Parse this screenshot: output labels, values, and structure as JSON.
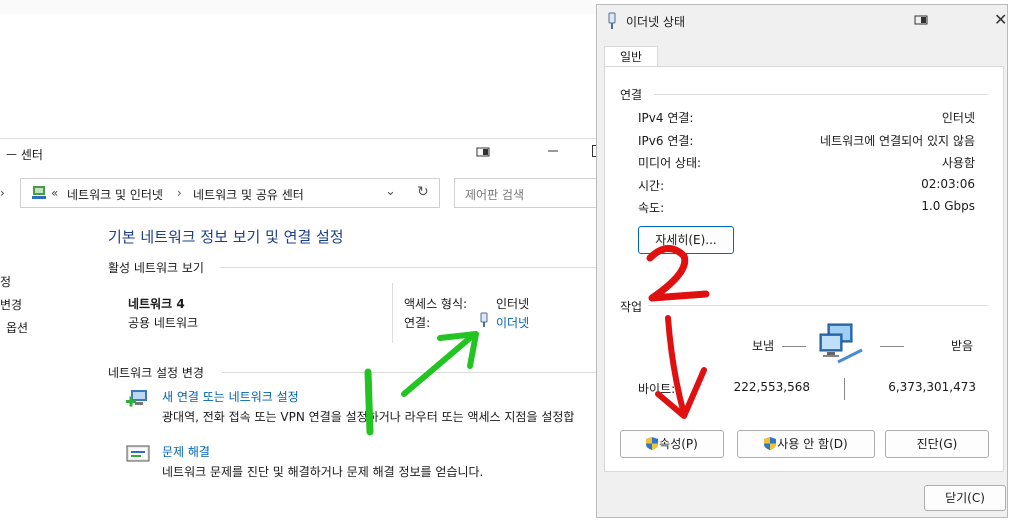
{
  "background_window": {
    "title_fragment": "ㅡ 센터",
    "breadcrumb": {
      "chevrons": "«",
      "items": [
        "네트워크 및 인터넷",
        "네트워크 및 공유 센터"
      ],
      "separator": "›"
    },
    "search_placeholder": "제어판 검색",
    "left_nav": [
      "정",
      "변경",
      "옵션"
    ],
    "heading": "기본 네트워크 정보 보기 및 연결 설정",
    "active_section": "활성 네트워크 보기",
    "network_name": "네트워크 4",
    "network_type": "공용 네트워크",
    "access_type_label": "액세스 형식:",
    "access_type_value": "인터넷",
    "connection_label": "연결:",
    "connection_value": "이더넷",
    "change_section": "네트워크 설정 변경",
    "new_connection_link": "새 연결 또는 네트워크 설정",
    "new_connection_desc": "광대역, 전화 접속 또는 VPN 연결을 설정하거나 라우터 또는 액세스 지점을 설정합",
    "troubleshoot_link": "문제 해결",
    "troubleshoot_desc": "네트워크 문제를 진단 및 해결하거나 문제 해결 정보를 얻습니다."
  },
  "dialog": {
    "title": "이더넷 상태",
    "tab": "일반",
    "connection_section": "연결",
    "rows": [
      {
        "label": "IPv4 연결:",
        "value": "인터넷"
      },
      {
        "label": "IPv6 연결:",
        "value": "네트워크에 연결되어 있지 않음"
      },
      {
        "label": "미디어 상태:",
        "value": "사용함"
      },
      {
        "label": "시간:",
        "value": "02:03:06"
      },
      {
        "label": "속도:",
        "value": "1.0 Gbps"
      }
    ],
    "details_button": "자세히(E)...",
    "activity_section": "작업",
    "sent_label": "보냄",
    "received_label": "받음",
    "bytes_label": "바이트:",
    "bytes_sent": "222,553,568",
    "bytes_received": "6,373,301,473",
    "properties_button": "속성(P)",
    "disable_button": "사용 안 함(D)",
    "diagnose_button": "진단(G)",
    "close_button": "닫기(C)"
  },
  "annotations": {
    "number_1": "1",
    "number_2": "2",
    "green": "#22c422",
    "red": "#e01010"
  },
  "colors": {
    "link": "#0063b1",
    "dialog_bg": "#f0f0f0"
  }
}
